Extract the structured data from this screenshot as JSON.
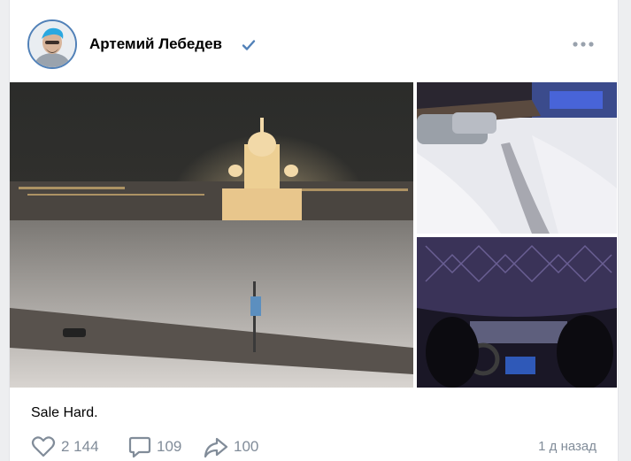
{
  "post": {
    "author": "Артемий Лебедев",
    "caption": "Sale Hard.",
    "likes": "2 144",
    "comments": "109",
    "shares": "100",
    "time": "1 д назад"
  },
  "icons": {
    "verified": "verified-check-icon",
    "more": "more-dots-icon",
    "like": "heart-icon",
    "comment": "comment-icon",
    "share": "share-arrow-icon"
  },
  "colors": {
    "accent": "#5181b8",
    "muted": "#818c99"
  }
}
